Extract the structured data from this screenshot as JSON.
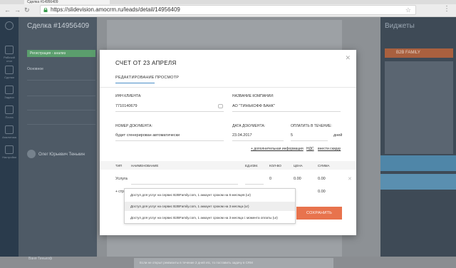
{
  "browser": {
    "tab_title": "Сделка #14956409",
    "url": "https://slidevision.amocrm.ru/leads/detail/14956409"
  },
  "background": {
    "lead_title": "Сделка #14956409",
    "status": "Регистрация - анализ",
    "tab_main": "Основное",
    "contact_name": "Олег Юрьевич Тенькин",
    "bottom_contact": "Ваня Тинькоф",
    "bottom_note": "Если не открыт реквизиты в течение 2 дней etc, то поставить задачу в CRM",
    "widgets_title": "Виджеты",
    "widget_badge": "B2B FAMILY",
    "nav_labels": [
      "Рабочий стол",
      "Сделки",
      "Задачи",
      "Почта",
      "Аналитика",
      "Настройки"
    ]
  },
  "modal": {
    "title": "СЧЕТ ОТ 23 АПРЕЛЯ",
    "tabs": [
      "РЕДАКТИРОВАНИЕ",
      "ПРОСМОТР"
    ],
    "fields": {
      "inn_label": "ИНН КЛИЕНТА:",
      "inn_value": "7710140679",
      "company_label": "НАЗВАНИЕ КОМПАНИИ:",
      "company_value": "АО \"ТИНЬКОФФ БАНК\"",
      "docnum_label": "НОМЕР ДОКУМЕНТА:",
      "docnum_value": "будет сгенерирован автоматически",
      "date_label": "ДАТА ДОКУМЕНТА:",
      "date_value": "23.04.2017",
      "pay_label": "ОПЛАТИТЬ В ТЕЧЕНИЕ:",
      "pay_value": "5",
      "pay_unit": "дней"
    },
    "links": {
      "additional": "+ дополнительная информация",
      "vat": "НДС",
      "discount": "внести скидку"
    },
    "table": {
      "headers": [
        "ТИП",
        "НАИМЕНОВАНИЕ",
        "ЕД.ИЗМ.",
        "КОЛ-ВО",
        "ЦЕНА",
        "СУММА"
      ],
      "row": {
        "type": "Услуга",
        "name": "",
        "unit": "",
        "qty": "0",
        "price": "0.00",
        "sum": "0.00"
      },
      "total": "0.00"
    },
    "add_link": "+ стр",
    "dropdown_options": [
      "Доступ для услуг на сервис B2BFamily.com, 1 аккаунт сроком на 6 месяцев (ur)",
      "Доступ для услуг на сервис B2BFamily.com, 1 аккаунт сроком на 3 месяца (ur)",
      "Доступ для услуг на сервис B2BFamily.com, 1 аккаунт сроком на 3 месяца с момента оплаты (ur)"
    ],
    "save_label": "СОХРАНИТЬ"
  }
}
